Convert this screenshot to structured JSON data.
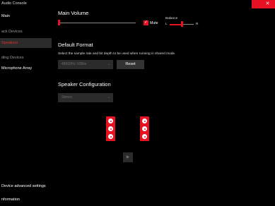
{
  "app": {
    "title": "Audio Console"
  },
  "window_controls": {
    "close_glyph": "✕",
    "accent": "#e81123"
  },
  "sidebar": {
    "main_item": "Main",
    "playback_header": "ack Devices",
    "playback_items": [
      {
        "label": "Speakers",
        "selected": true
      }
    ],
    "recording_header": "ding Devices",
    "recording_items": [
      {
        "label": "Microphone Array"
      }
    ],
    "bottom_items": [
      {
        "label": "Device advanced settings"
      },
      {
        "label": "nformation"
      }
    ]
  },
  "main_volume": {
    "heading": "Main Volume",
    "volume_level": 0,
    "mute_label": "Mute",
    "mute_checked": true,
    "balance_label": "Balance",
    "balance_left": "L",
    "balance_right": "R",
    "balance_level": 0.5
  },
  "default_format": {
    "heading": "Default Format",
    "description": "Select the sample rate and bit depth to be used when running in shared mode.",
    "selected_value": "48000Hz 16Bits",
    "reset_label": "Reset"
  },
  "speaker_configuration": {
    "heading": "Speaker Configuration",
    "selected_value": "Stereo",
    "speakers": [
      {
        "name": "left"
      },
      {
        "name": "right"
      }
    ],
    "play_glyph": "▶"
  }
}
